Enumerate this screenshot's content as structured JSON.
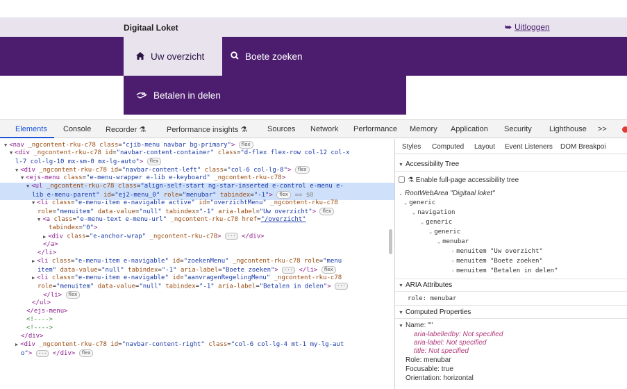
{
  "site": {
    "brand": "Digitaal Loket",
    "logout": "Uitloggen",
    "nav": [
      {
        "label": "Uw overzicht",
        "icon": "home-icon"
      },
      {
        "label": "Boete zoeken",
        "icon": "search-icon"
      },
      {
        "label": "Betalen in delen",
        "icon": "payment-icon"
      }
    ],
    "colors": {
      "nav_bg": "#4c1d6e",
      "topbar_bg": "#e9e3ee"
    }
  },
  "devtools": {
    "tabs": [
      "Elements",
      "Console",
      "Recorder",
      "Performance insights",
      "Sources",
      "Network",
      "Performance",
      "Memory",
      "Application",
      "Security",
      "Lighthouse",
      ">>"
    ],
    "side_tabs": [
      "Styles",
      "Computed",
      "Layout",
      "Event Listeners",
      "DOM Breakpoi"
    ],
    "accessibility": {
      "section_title": "Accessibility Tree",
      "checkbox_label": "Enable full-page accessibility tree",
      "tree": [
        "RootWebArea \"Digitaal loket\"",
        "generic",
        "navigation",
        "generic",
        "generic",
        "menubar",
        "menuitem \"Uw overzicht\"",
        "menuitem \"Boete zoeken\"",
        "menuitem \"Betalen in delen\""
      ]
    },
    "aria": {
      "section_title": "ARIA Attributes",
      "role": "role: menubar"
    },
    "computed": {
      "section_title": "Computed Properties",
      "name_label": "Name: \"\"",
      "labelledby": "aria-labelledby: Not specified",
      "label": "aria-label: Not specified",
      "title": "title: Not specified",
      "role": "Role: menubar",
      "focusable": "Focusable: true",
      "orientation": "Orientation: horizontal"
    },
    "dom_lines": [
      "▼<nav _ngcontent-rku-c78 class=\"cjib-menu navbar bg-primary\"> flex",
      "▼<div _ngcontent-rku-c78 id=\"navbar-content-container\" class=\"d-flex flex-row col-12 col-x",
      "l-7 col-lg-10 mx-sm-0 mx-lg-auto\"> flex",
      "▼<div _ngcontent-rku-c78 id=\"navbar-content-left\" class=\"col-6 col-lg-8\"> flex",
      "▼<ejs-menu class=\"e-menu-wrapper e-lib e-keyboard\" _ngcontent-rku-c78>",
      "▼<ul _ngcontent-rku-c78 class=\"align-self-start ng-star-inserted e-control e-menu e-",
      "lib e-menu-parent\" id=\"ej2-menu_0\" role=\"menubar\" tabindex=\"-1\"> flex == $0",
      "▼<li class=\"e-menu-item e-navigable active\" id=\"overzichtMenu\" _ngcontent-rku-c78",
      "role=\"menuitem\" data-value=\"null\" tabindex=\"-1\" aria-label=\"Uw overzicht\"> flex",
      "▼<a class=\"e-menu-text e-menu-url\" _ngcontent-rku-c78 href=\"/overzicht\"",
      "tabindex=\"0\">",
      "▶<div class=\"e-anchor-wrap\" _ngcontent-rku-c78> ··· </div>",
      "</a>",
      "</li>",
      "▶<li class=\"e-menu-item e-navigable\" id=\"zoekenMenu\" _ngcontent-rku-c78 role=\"menu",
      "item\" data-value=\"null\" tabindex=\"-1\" aria-label=\"Boete zoeken\"> ··· </li> flex",
      "▶<li class=\"e-menu-item e-navigable\" id=\"aanvragenRegelingMenu\" _ngcontent-rku-c78",
      "role=\"menuitem\" data-value=\"null\" tabindex=\"-1\" aria-label=\"Betalen in delen\"> ···",
      "</li> flex",
      "</ul>",
      "</ejs-menu>",
      "<!---->",
      "<!---->",
      "</div>",
      "▶<div _ngcontent-rku-c78 id=\"navbar-content-right\" class=\"col-6 col-lg-4 mt-1 my-lg-aut",
      "o\"> ··· </div> flex"
    ]
  }
}
